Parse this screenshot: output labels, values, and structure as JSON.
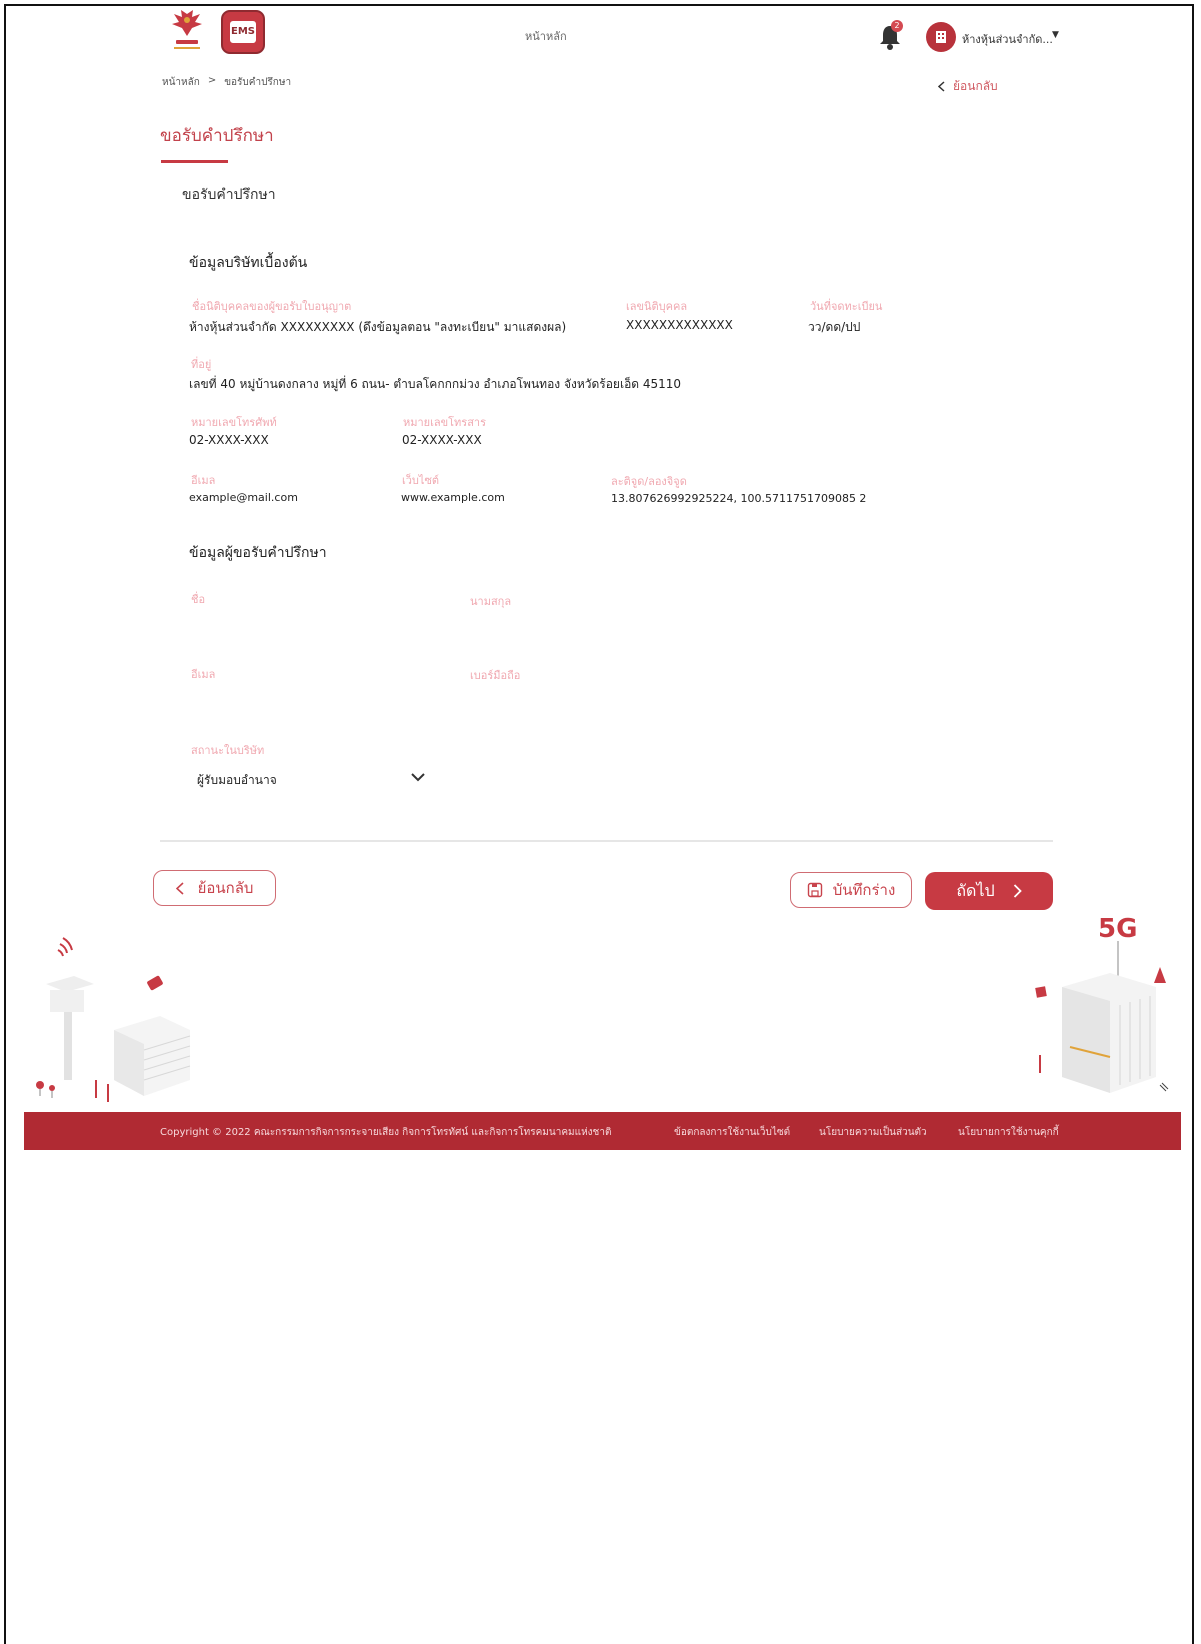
{
  "header": {
    "nav_home": "หน้าหลัก",
    "logo_app_text": "EMS",
    "notification_count": "2",
    "user_name": "ห้างหุ้นส่วนจำกัด..."
  },
  "breadcrumb": {
    "home": "หน้าหลัก",
    "separator": ">",
    "current": "ขอรับคำปรึกษา"
  },
  "back_top_label": "ย้อนกลับ",
  "page_title": "ขอรับคำปรึกษา",
  "tab_label": "ขอรับคำปรึกษา",
  "company_section": {
    "heading": "ข้อมูลบริษัทเบื้องต้น",
    "fields": {
      "name_label": "ชื่อนิติบุคคลของผู้ขอรับใบอนุญาต",
      "name_value": "ห้างหุ้นส่วนจำกัด XXXXXXXXX (ดึงข้อมูลตอน \"ลงทะเบียน\" มาแสดงผล)",
      "juristic_id_label": "เลขนิติบุคคล",
      "juristic_id_value": "XXXXXXXXXXXXX",
      "reg_date_label": "วันที่จดทะเบียน",
      "reg_date_value": "วว/ดด/ปป",
      "address_label": "ที่อยู่",
      "address_value": "เลขที่ 40 หมู่บ้านดงกลาง หมู่ที่ 6 ถนน- ตำบลโคกกกม่วง อำเภอโพนทอง จังหวัดร้อยเอ็ด 45110",
      "phone_label": "หมายเลขโทรศัพท์",
      "phone_value": "02-XXXX-XXX",
      "fax_label": "หมายเลขโทรสาร",
      "fax_value": "02-XXXX-XXX",
      "email_label": "อีเมล",
      "email_value": "example@mail.com",
      "website_label": "เว็บไซต์",
      "website_value": "www.example.com",
      "latlng_label": "ละติจูด/ลองจิจูด",
      "latlng_value": "13.807626992925224, 100.5711751709085 2"
    }
  },
  "requester_section": {
    "heading": "ข้อมูลผู้ขอรับคำปรึกษา",
    "first_name_label": "ชื่อ",
    "last_name_label": "นามสกุล",
    "email_label": "อีเมล",
    "mobile_label": "เบอร์มือถือ",
    "status_label": "สถานะในบริษัท",
    "status_value": "ผู้รับมอบอำนาจ"
  },
  "buttons": {
    "back": "ย้อนกลับ",
    "save_draft": "บันทึกร่าง",
    "next": "ถัดไป"
  },
  "illustration": {
    "label_5g": "5G"
  },
  "footer": {
    "copyright": "Copyright © 2022 คณะกรรมการกิจการกระจายเสียง กิจการโทรทัศน์ และกิจการโทรคมนาคมแห่งชาติ",
    "terms": "ข้อตกลงการใช้งานเว็บไซต์",
    "privacy": "นโยบายความเป็นส่วนตัว",
    "cookie": "นโยบายการใช้งานคุกกี้"
  },
  "colors": {
    "accent": "#c73a43",
    "label_pink": "#f0a8b0",
    "footer_bg": "#b02a33"
  }
}
